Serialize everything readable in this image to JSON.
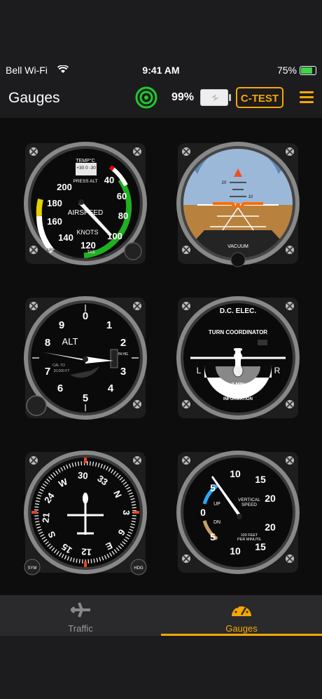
{
  "status_bar": {
    "carrier": "Bell Wi-Fi",
    "time": "9:41 AM",
    "battery": "75%"
  },
  "header": {
    "title": "Gauges",
    "device_battery": "99%",
    "test_button": "C-TEST"
  },
  "gauges": {
    "airspeed": {
      "label": "AIRSPEED",
      "unit": "KNOTS",
      "tas": "TAS",
      "temp": "TEMP°C",
      "press": "PRESS ALT",
      "temp_scale": "+30 0 -30",
      "nums": [
        "40",
        "60",
        "80",
        "100",
        "120",
        "140",
        "160",
        "180",
        "200"
      ],
      "tas_nums": [
        "180",
        "160",
        "140"
      ]
    },
    "attitude": {
      "label": "VACUUM",
      "pitch_nums": [
        "20",
        "10",
        "10",
        "20"
      ]
    },
    "altimeter": {
      "label": "ALT",
      "nums": [
        "0",
        "1",
        "2",
        "3",
        "4",
        "5",
        "6",
        "7",
        "8",
        "9"
      ],
      "inhg": "IN HG",
      "cal": "CAL TO",
      "cal_val": "20,000 FT"
    },
    "turn_coordinator": {
      "top": "D.C. ELEC.",
      "title": "TURN COORDINATOR",
      "left": "L",
      "right": "R",
      "minutes": "2 MIN",
      "note1": "NO PITCH",
      "note2": "INFORMATION"
    },
    "heading": {
      "sym": "SYM",
      "hdg": "HDG",
      "labels": [
        "N",
        "3",
        "6",
        "E",
        "12",
        "15",
        "S",
        "21",
        "24",
        "W",
        "30",
        "33"
      ]
    },
    "vsi": {
      "title1": "VERTICAL",
      "title2": "SPEED",
      "up": "UP",
      "dn": "DN",
      "sub1": "100 FEET",
      "sub2": "PER MINUTE",
      "nums": [
        "0",
        "5",
        "10",
        "15",
        "20",
        "20",
        "15",
        "10",
        "5"
      ]
    }
  },
  "tabs": [
    {
      "label": "Traffic",
      "active": false
    },
    {
      "label": "Gauges",
      "active": true
    }
  ],
  "colors": {
    "accent": "#f5a800",
    "status_green": "#1ecb2a"
  }
}
